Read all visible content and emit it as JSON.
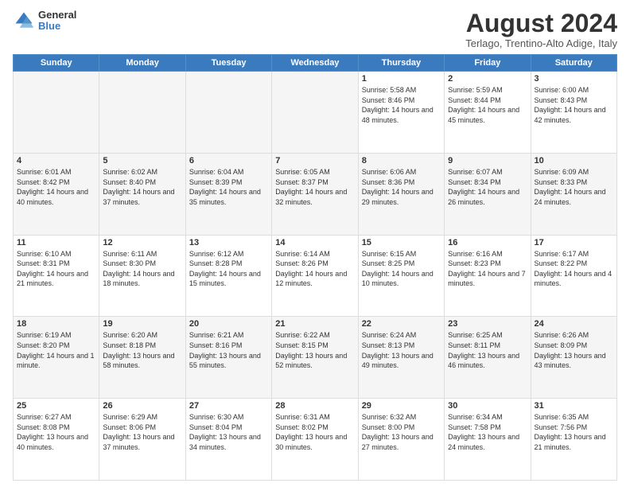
{
  "header": {
    "logo_general": "General",
    "logo_blue": "Blue",
    "month_title": "August 2024",
    "subtitle": "Terlago, Trentino-Alto Adige, Italy"
  },
  "weekdays": [
    "Sunday",
    "Monday",
    "Tuesday",
    "Wednesday",
    "Thursday",
    "Friday",
    "Saturday"
  ],
  "weeks": [
    [
      {
        "num": "",
        "info": ""
      },
      {
        "num": "",
        "info": ""
      },
      {
        "num": "",
        "info": ""
      },
      {
        "num": "",
        "info": ""
      },
      {
        "num": "1",
        "info": "Sunrise: 5:58 AM\nSunset: 8:46 PM\nDaylight: 14 hours and 48 minutes."
      },
      {
        "num": "2",
        "info": "Sunrise: 5:59 AM\nSunset: 8:44 PM\nDaylight: 14 hours and 45 minutes."
      },
      {
        "num": "3",
        "info": "Sunrise: 6:00 AM\nSunset: 8:43 PM\nDaylight: 14 hours and 42 minutes."
      }
    ],
    [
      {
        "num": "4",
        "info": "Sunrise: 6:01 AM\nSunset: 8:42 PM\nDaylight: 14 hours and 40 minutes."
      },
      {
        "num": "5",
        "info": "Sunrise: 6:02 AM\nSunset: 8:40 PM\nDaylight: 14 hours and 37 minutes."
      },
      {
        "num": "6",
        "info": "Sunrise: 6:04 AM\nSunset: 8:39 PM\nDaylight: 14 hours and 35 minutes."
      },
      {
        "num": "7",
        "info": "Sunrise: 6:05 AM\nSunset: 8:37 PM\nDaylight: 14 hours and 32 minutes."
      },
      {
        "num": "8",
        "info": "Sunrise: 6:06 AM\nSunset: 8:36 PM\nDaylight: 14 hours and 29 minutes."
      },
      {
        "num": "9",
        "info": "Sunrise: 6:07 AM\nSunset: 8:34 PM\nDaylight: 14 hours and 26 minutes."
      },
      {
        "num": "10",
        "info": "Sunrise: 6:09 AM\nSunset: 8:33 PM\nDaylight: 14 hours and 24 minutes."
      }
    ],
    [
      {
        "num": "11",
        "info": "Sunrise: 6:10 AM\nSunset: 8:31 PM\nDaylight: 14 hours and 21 minutes."
      },
      {
        "num": "12",
        "info": "Sunrise: 6:11 AM\nSunset: 8:30 PM\nDaylight: 14 hours and 18 minutes."
      },
      {
        "num": "13",
        "info": "Sunrise: 6:12 AM\nSunset: 8:28 PM\nDaylight: 14 hours and 15 minutes."
      },
      {
        "num": "14",
        "info": "Sunrise: 6:14 AM\nSunset: 8:26 PM\nDaylight: 14 hours and 12 minutes."
      },
      {
        "num": "15",
        "info": "Sunrise: 6:15 AM\nSunset: 8:25 PM\nDaylight: 14 hours and 10 minutes."
      },
      {
        "num": "16",
        "info": "Sunrise: 6:16 AM\nSunset: 8:23 PM\nDaylight: 14 hours and 7 minutes."
      },
      {
        "num": "17",
        "info": "Sunrise: 6:17 AM\nSunset: 8:22 PM\nDaylight: 14 hours and 4 minutes."
      }
    ],
    [
      {
        "num": "18",
        "info": "Sunrise: 6:19 AM\nSunset: 8:20 PM\nDaylight: 14 hours and 1 minute."
      },
      {
        "num": "19",
        "info": "Sunrise: 6:20 AM\nSunset: 8:18 PM\nDaylight: 13 hours and 58 minutes."
      },
      {
        "num": "20",
        "info": "Sunrise: 6:21 AM\nSunset: 8:16 PM\nDaylight: 13 hours and 55 minutes."
      },
      {
        "num": "21",
        "info": "Sunrise: 6:22 AM\nSunset: 8:15 PM\nDaylight: 13 hours and 52 minutes."
      },
      {
        "num": "22",
        "info": "Sunrise: 6:24 AM\nSunset: 8:13 PM\nDaylight: 13 hours and 49 minutes."
      },
      {
        "num": "23",
        "info": "Sunrise: 6:25 AM\nSunset: 8:11 PM\nDaylight: 13 hours and 46 minutes."
      },
      {
        "num": "24",
        "info": "Sunrise: 6:26 AM\nSunset: 8:09 PM\nDaylight: 13 hours and 43 minutes."
      }
    ],
    [
      {
        "num": "25",
        "info": "Sunrise: 6:27 AM\nSunset: 8:08 PM\nDaylight: 13 hours and 40 minutes."
      },
      {
        "num": "26",
        "info": "Sunrise: 6:29 AM\nSunset: 8:06 PM\nDaylight: 13 hours and 37 minutes."
      },
      {
        "num": "27",
        "info": "Sunrise: 6:30 AM\nSunset: 8:04 PM\nDaylight: 13 hours and 34 minutes."
      },
      {
        "num": "28",
        "info": "Sunrise: 6:31 AM\nSunset: 8:02 PM\nDaylight: 13 hours and 30 minutes."
      },
      {
        "num": "29",
        "info": "Sunrise: 6:32 AM\nSunset: 8:00 PM\nDaylight: 13 hours and 27 minutes."
      },
      {
        "num": "30",
        "info": "Sunrise: 6:34 AM\nSunset: 7:58 PM\nDaylight: 13 hours and 24 minutes."
      },
      {
        "num": "31",
        "info": "Sunrise: 6:35 AM\nSunset: 7:56 PM\nDaylight: 13 hours and 21 minutes."
      }
    ]
  ]
}
